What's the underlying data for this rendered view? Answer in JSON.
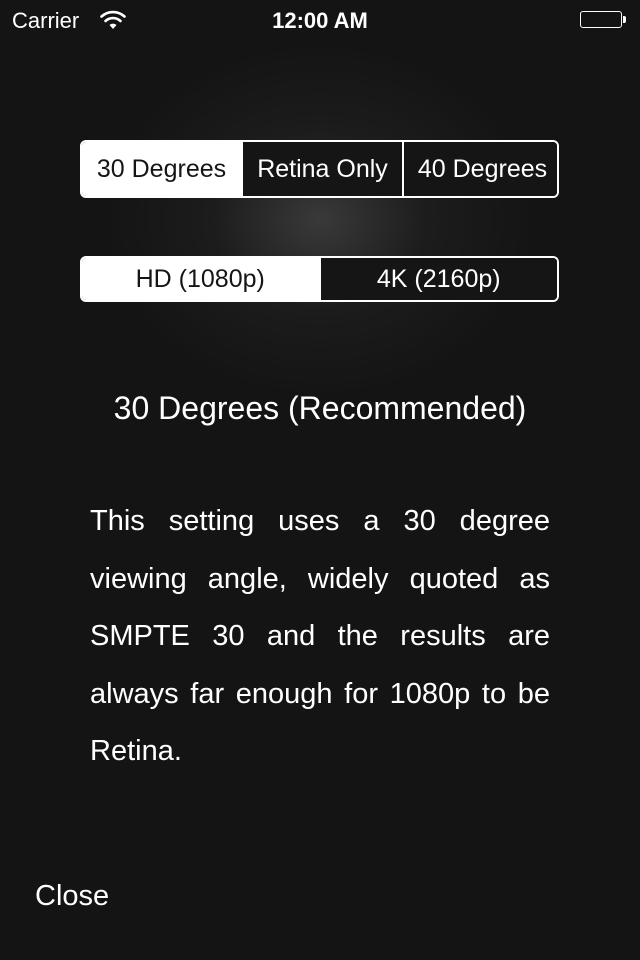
{
  "status_bar": {
    "carrier": "Carrier",
    "time": "12:00 AM",
    "wifi_icon": "wifi-icon",
    "battery_icon": "battery-full-icon"
  },
  "angle_control": {
    "options": [
      "30 Degrees",
      "Retina Only",
      "40 Degrees"
    ],
    "selected": "30 Degrees"
  },
  "resolution_control": {
    "options": [
      "HD (1080p)",
      "4K (2160p)"
    ],
    "selected": "HD (1080p)"
  },
  "info": {
    "heading": "30 Degrees (Recommended)",
    "description": "This setting uses a 30 degree viewing angle, widely quoted as SMPTE 30 and the results are always far enough for 1080p to be Retina."
  },
  "footer": {
    "close_label": "Close"
  },
  "colors": {
    "background": "#141414",
    "foreground": "#ffffff"
  }
}
